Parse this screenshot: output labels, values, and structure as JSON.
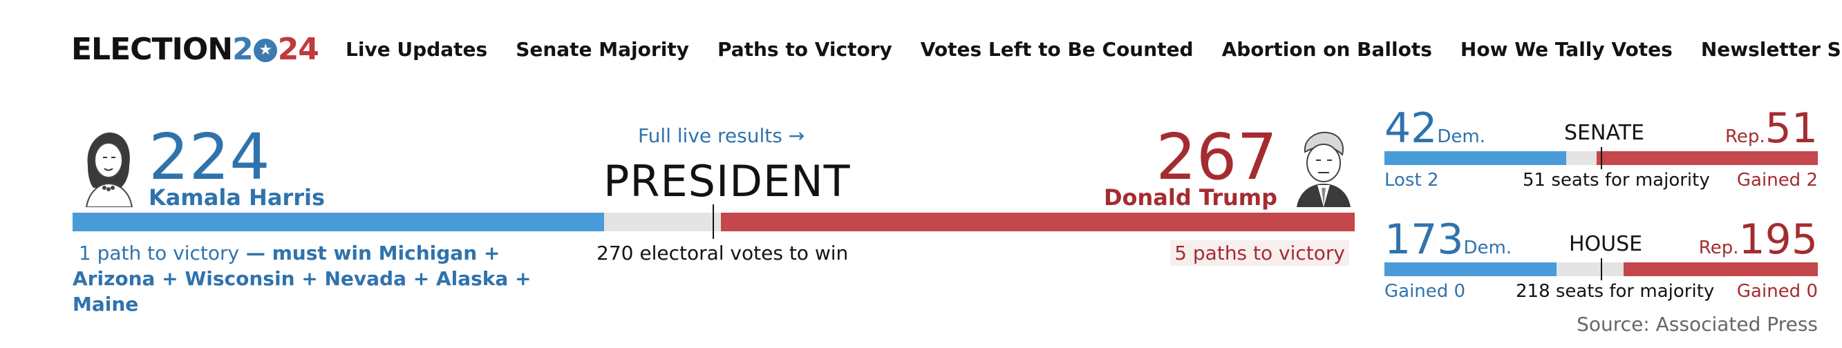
{
  "header": {
    "logo": {
      "word": "ELECTION",
      "year_a": "2",
      "year_b": "24",
      "star": "★"
    },
    "nav": [
      {
        "label": "Live Updates"
      },
      {
        "label": "Senate Majority"
      },
      {
        "label": "Paths to Victory"
      },
      {
        "label": "Votes Left to Be Counted"
      },
      {
        "label": "Abortion on Ballots"
      },
      {
        "label": "How We Tally Votes"
      },
      {
        "label": "Newsletter Sign-Up"
      }
    ]
  },
  "president": {
    "title": "PRESIDENT",
    "live_link": "Full live results →",
    "dem": {
      "votes": "224",
      "name": "Kamala Harris",
      "portrait_icon": "kamala-harris-portrait",
      "vote_fraction": 0.4148
    },
    "rep": {
      "votes": "267",
      "name": "Donald Trump",
      "portrait_icon": "donald-trump-portrait",
      "vote_fraction": 0.4944
    },
    "dem_path_lead": "1 path to victory",
    "dem_path_detail": " — must win Michigan + Arizona + Wisconsin + Nevada + Alaska + Maine",
    "needed": "270 electoral votes to win",
    "rep_paths": "5 paths to victory"
  },
  "senate": {
    "title": "SENATE",
    "dem_count": "42",
    "dem_label": "Dem.",
    "rep_count": "51",
    "rep_label": "Rep.",
    "dem_change": "Lost 2",
    "rep_change": "Gained 2",
    "majority": "51 seats for majority",
    "dem_fraction": 0.42,
    "rep_fraction": 0.51
  },
  "house": {
    "title": "HOUSE",
    "dem_count": "173",
    "dem_label": "Dem.",
    "rep_count": "195",
    "rep_label": "Rep.",
    "dem_change": "Gained 0",
    "rep_change": "Gained 0",
    "majority": "218 seats for majority",
    "dem_fraction": 0.3977,
    "rep_fraction": 0.4483
  },
  "source": "Source: Associated Press",
  "colors": {
    "dem": "#4a9bd9",
    "rep": "#c3474b",
    "remaining": "#e4e4e4"
  }
}
